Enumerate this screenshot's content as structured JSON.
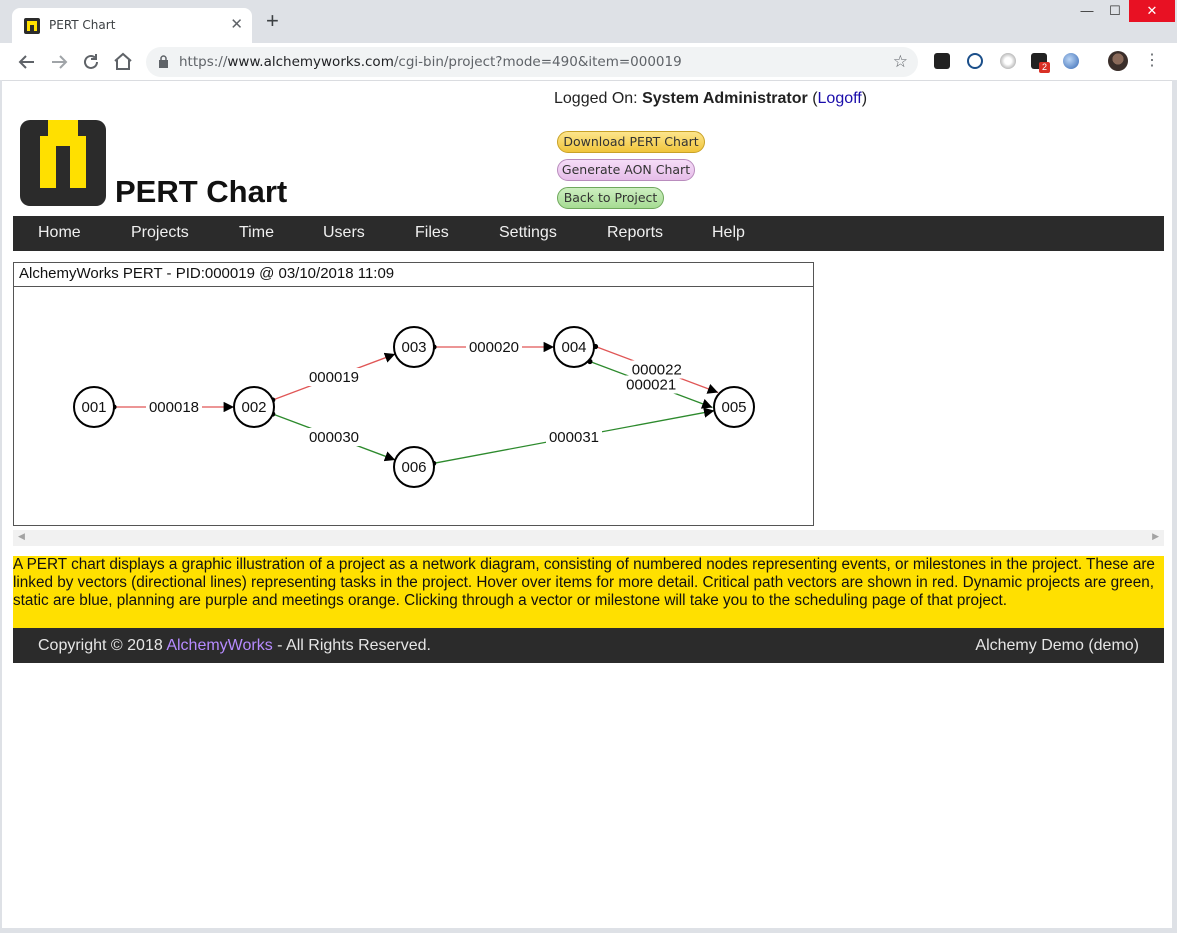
{
  "browser": {
    "tab_title": "PERT Chart",
    "close_glyph": "✕",
    "new_tab_glyph": "+",
    "url_scheme": "https://",
    "url_host": "www.alchemyworks.com",
    "url_path": "/cgi-bin/project?mode=490&item=000019",
    "extension_badge": "2",
    "window_controls": {
      "minimize": "—",
      "maximize": "☐",
      "close": "✕"
    }
  },
  "header": {
    "login_prefix": "Logged On: ",
    "user_name": "System Administrator",
    "logoff_open": " (",
    "logoff_label": "Logoff",
    "logoff_close": ")",
    "page_title": "PERT Chart",
    "buttons": {
      "download": "Download PERT Chart",
      "aon": "Generate AON Chart",
      "back": "Back to Project"
    }
  },
  "menu": [
    "Home",
    "Projects",
    "Time",
    "Users",
    "Files",
    "Settings",
    "Reports",
    "Help"
  ],
  "chart": {
    "title": "AlchemyWorks PERT - PID:000019 @ 03/10/2018 11:09"
  },
  "colors": {
    "critical": "#e05656",
    "dynamic": "#2d8a2d",
    "node_stroke": "#000000",
    "menu_bg": "#2b2b2b",
    "info_bg": "#ffe000",
    "logo_yellow": "#ffe000"
  },
  "diagram": {
    "nodes": [
      {
        "id": "001",
        "col": 0,
        "row": 1
      },
      {
        "id": "002",
        "col": 1,
        "row": 1
      },
      {
        "id": "003",
        "col": 2,
        "row": 0
      },
      {
        "id": "004",
        "col": 3,
        "row": 0
      },
      {
        "id": "005",
        "col": 4,
        "row": 1
      },
      {
        "id": "006",
        "col": 2,
        "row": 2
      }
    ],
    "edges": [
      {
        "label": "000018",
        "from": "001",
        "to": "002",
        "type": "critical"
      },
      {
        "label": "000019",
        "from": "002",
        "to": "003",
        "type": "critical"
      },
      {
        "label": "000020",
        "from": "003",
        "to": "004",
        "type": "critical"
      },
      {
        "label": "000022",
        "from": "004",
        "to": "005",
        "type": "critical"
      },
      {
        "label": "000021",
        "from": "004",
        "to": "005",
        "type": "dynamic"
      },
      {
        "label": "000030",
        "from": "002",
        "to": "006",
        "type": "dynamic"
      },
      {
        "label": "000031",
        "from": "006",
        "to": "005",
        "type": "dynamic"
      }
    ]
  },
  "info_text": "A PERT chart displays a graphic illustration of a project as a network diagram, consisting of numbered nodes representing events, or milestones in the project. These are linked by vectors (directional lines) representing tasks in the project. Hover over items for more detail. Critical path vectors are shown in red. Dynamic projects are green, static are blue, planning are purple and meetings orange. Clicking through a vector or milestone will take you to the scheduling page of that project.",
  "footer": {
    "copyright_prefix": "Copyright © 2018 ",
    "company": "AlchemyWorks",
    "copyright_suffix": " - All Rights Reserved.",
    "account": "Alchemy Demo (demo)"
  }
}
